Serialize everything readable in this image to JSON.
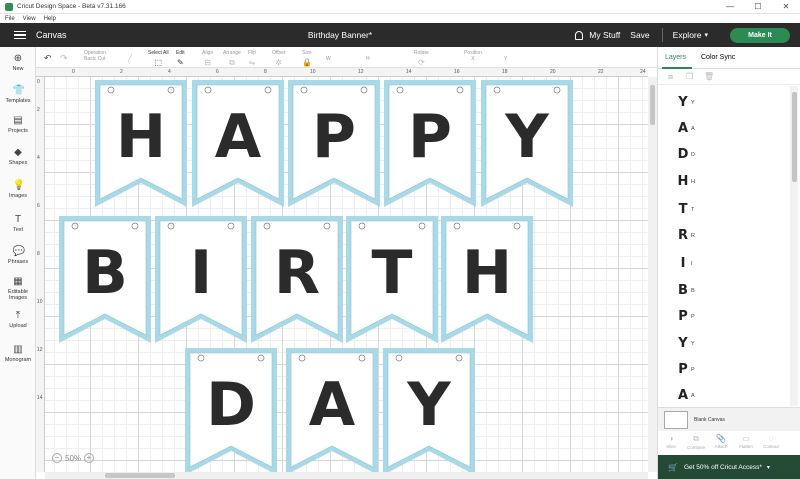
{
  "window": {
    "title": "Cricut Design Space - Beta v7.31.166",
    "controls": [
      "—",
      "☐",
      "✕"
    ]
  },
  "menu": [
    "File",
    "View",
    "Help"
  ],
  "header": {
    "section": "Canvas",
    "doc_title": "Birthday Banner*",
    "my_stuff": "My Stuff",
    "save": "Save",
    "explore": "Explore",
    "make_it": "Make It"
  },
  "left_tools": [
    {
      "label": "New",
      "icon": "⊕"
    },
    {
      "label": "Templates",
      "icon": "👕"
    },
    {
      "label": "Projects",
      "icon": "▤"
    },
    {
      "label": "Shapes",
      "icon": "◆"
    },
    {
      "label": "Images",
      "icon": "💡"
    },
    {
      "label": "Text",
      "icon": "T"
    },
    {
      "label": "Phrases",
      "icon": "💬"
    },
    {
      "label": "Editable Images",
      "icon": "▦"
    },
    {
      "label": "Upload",
      "icon": "⤒"
    },
    {
      "label": "Monogram",
      "icon": "▥"
    }
  ],
  "edit_tools": {
    "operation_label": "Operation",
    "operation_value": "Basic Cut",
    "select_all": "Select All",
    "edit": "Edit",
    "align": "Align",
    "arrange": "Arrange",
    "flip": "Flip",
    "offset": "Offset",
    "size": "Size",
    "size_w": "W",
    "size_h": "H",
    "rotate": "Rotate",
    "position": "Position",
    "pos_x": "X",
    "pos_y": "Y"
  },
  "ruler": {
    "h": [
      "0",
      "2",
      "4",
      "6",
      "8",
      "10",
      "12",
      "14",
      "16",
      "18",
      "20",
      "22",
      "24"
    ],
    "v": [
      "0",
      "2",
      "4",
      "6",
      "8",
      "10",
      "12",
      "14"
    ]
  },
  "banner": {
    "rows": [
      [
        "H",
        "A",
        "P",
        "P",
        "Y"
      ],
      [
        "B",
        "I",
        "R",
        "T",
        "H"
      ],
      [
        "D",
        "A",
        "Y"
      ]
    ]
  },
  "zoom": {
    "value": "50%",
    "minus": "−",
    "plus": "+"
  },
  "panel": {
    "tabs": [
      "Layers",
      "Color Sync"
    ],
    "layers": [
      "Y",
      "A",
      "D",
      "H",
      "T",
      "R",
      "I",
      "B",
      "P",
      "Y",
      "P",
      "A"
    ],
    "blank_canvas": "Blank Canvas",
    "bottom_tools": [
      "Slice",
      "Combine",
      "Attach",
      "Flatten",
      "Contour"
    ],
    "promo": "Get 50% off Cricut Access*"
  },
  "colors": {
    "header_bg": "#2b2b2b",
    "accent": "#2c8a55",
    "pennant_border": "#a9d8e6",
    "letter": "#2b2b2b"
  }
}
